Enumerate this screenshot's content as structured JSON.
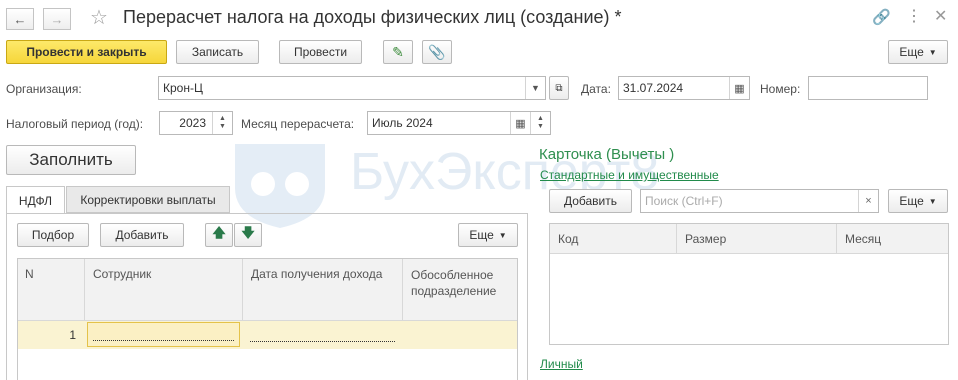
{
  "window": {
    "title": "Перерасчет налога на доходы физических лиц (создание) *"
  },
  "toolbar": {
    "post_close_label": "Провести и закрыть",
    "save_label": "Записать",
    "post_label": "Провести",
    "more_label": "Еще"
  },
  "header": {
    "org_label": "Организация:",
    "org_value": "Крон-Ц",
    "date_label": "Дата:",
    "date_value": "31.07.2024",
    "number_label": "Номер:",
    "number_value": "",
    "period_label": "Налоговый период (год):",
    "period_value": "2023",
    "month_label": "Месяц перерасчета:",
    "month_value": "Июль 2024"
  },
  "fill_label": "Заполнить",
  "tabs": [
    {
      "label": "НДФЛ",
      "active": true
    },
    {
      "label": "Корректировки выплаты",
      "active": false
    }
  ],
  "left_panel": {
    "select_label": "Подбор",
    "add_label": "Добавить",
    "more_label": "Еще",
    "columns": [
      "N",
      "Сотрудник",
      "Дата получения дохода",
      "Обособленное подразделение"
    ],
    "rows": [
      {
        "n": "1",
        "employee": "",
        "date": "",
        "dept": ""
      }
    ]
  },
  "right_panel": {
    "title": "Карточка (Вычеты )",
    "subtitle_link": "Стандартные и имущественные",
    "add_label": "Добавить",
    "search_placeholder": "Поиск (Ctrl+F)",
    "more_label": "Еще",
    "columns": [
      "Код",
      "Размер",
      "Месяц"
    ],
    "personal_link": "Личный"
  },
  "watermark": "БухЭксперт8",
  "colors": {
    "primary_button": "#f6d63a",
    "link": "#228b4b",
    "selected_row": "#faf3d2",
    "watermark": "#dde8f3"
  }
}
